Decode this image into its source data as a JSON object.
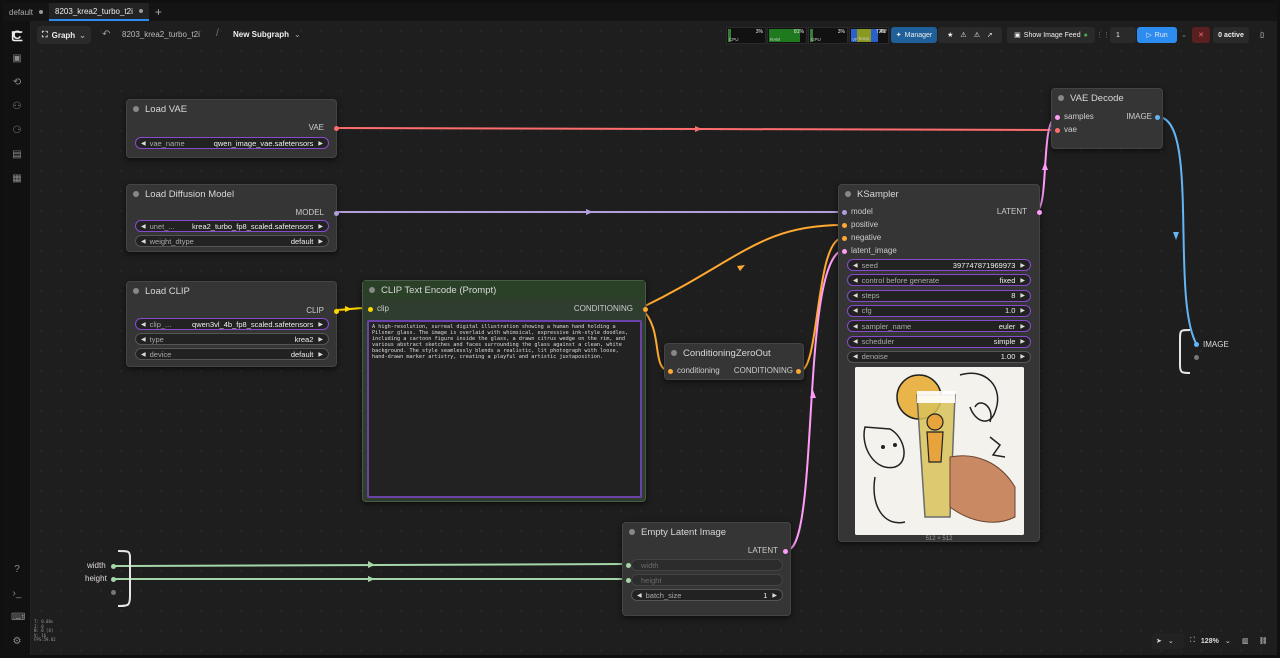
{
  "tabs": [
    {
      "label": "default",
      "active": false
    },
    {
      "label": "8203_krea2_turbo_t2i",
      "active": true
    }
  ],
  "toolbar": {
    "graph_label": "Graph",
    "breadcrumb_workflow": "8203_krea2_turbo_t2i",
    "breadcrumb_sep": "/",
    "breadcrumb_subgraph": "New Subgraph",
    "stats": [
      {
        "label": "CPU",
        "pct": "3%",
        "level": 0.03,
        "color": "#3a7d3a"
      },
      {
        "label": "RAM",
        "pct": "81%",
        "level": 0.81,
        "color": "#1f7a1f"
      },
      {
        "label": "GPU",
        "pct": "3%",
        "level": 0.03,
        "color": "#3a7d3a"
      },
      {
        "label": "VRAM",
        "pct": "72%",
        "level": 0.72,
        "color": "#2b5fc9"
      },
      {
        "label": "Temp",
        "pct": "45°",
        "level": 0.45,
        "color": "#8a9a20"
      }
    ],
    "manager_label": "Manager",
    "image_feed_label": "Show Image Feed",
    "batch_count": "1",
    "run_label": "Run",
    "active_label": "0 active",
    "accent": "#2d8cf0"
  },
  "nodes": {
    "load_vae": {
      "title": "Load VAE",
      "output": "VAE",
      "widget_name": "vae_name",
      "widget_value": "qwen_image_vae.safetensors"
    },
    "load_diffusion": {
      "title": "Load Diffusion Model",
      "output": "MODEL",
      "w1_name": "unet_...",
      "w1_value": "krea2_turbo_fp8_scaled.safetensors",
      "w2_name": "weight_dtype",
      "w2_value": "default"
    },
    "load_clip": {
      "title": "Load CLIP",
      "output": "CLIP",
      "w1_name": "clip_...",
      "w1_value": "qwen3vl_4b_fp8_scaled.safetensors",
      "w2_name": "type",
      "w2_value": "krea2",
      "w3_name": "device",
      "w3_value": "default"
    },
    "clip_text": {
      "title": "CLIP Text Encode (Prompt)",
      "input": "clip",
      "output": "CONDITIONING",
      "prompt": "A high-resolution, surreal digital illustration showing a human hand holding a Pilsner glass. The image is overlaid with whimsical, expressive ink-style doodles, including a cartoon figure inside the glass, a drawn citrus wedge on the rim, and various abstract sketches and faces surrounding the glass against a clean, white background. The style seamlessly blends a realistic, lit photograph with loose, hand-drawn marker artistry, creating a playful and artistic juxtaposition."
    },
    "cond_zero": {
      "title": "ConditioningZeroOut",
      "input": "conditioning",
      "output": "CONDITIONING"
    },
    "ksampler": {
      "title": "KSampler",
      "inputs": [
        "model",
        "positive",
        "negative",
        "latent_image"
      ],
      "output": "LATENT",
      "widgets": [
        {
          "name": "seed",
          "value": "397747871969973"
        },
        {
          "name": "control before generate",
          "value": "fixed"
        },
        {
          "name": "steps",
          "value": "8"
        },
        {
          "name": "cfg",
          "value": "1.0"
        },
        {
          "name": "sampler_name",
          "value": "euler"
        },
        {
          "name": "scheduler",
          "value": "simple"
        },
        {
          "name": "denoise",
          "value": "1.00"
        }
      ],
      "preview_size": "512 × 512"
    },
    "vae_decode": {
      "title": "VAE Decode",
      "inputs": [
        "samples",
        "vae"
      ],
      "output": "IMAGE"
    },
    "empty_latent": {
      "title": "Empty Latent Image",
      "output": "LATENT",
      "w1": "width",
      "w2": "height",
      "w3_name": "batch_size",
      "w3_value": "1"
    }
  },
  "subgraph_inputs": [
    "width",
    "height"
  ],
  "subgraph_output": "IMAGE",
  "bottom_info": [
    "T: 0.00s",
    "I: 0",
    "N: 8 [8]",
    "V: 16",
    "FPS:59.82"
  ],
  "zoom": "128%",
  "colors": {
    "vae": "#ff6e6e",
    "model": "#b39ddb",
    "clip": "#ffd500",
    "conditioning": "#ffa931",
    "latent": "#ff9cf9",
    "image": "#64b5f6",
    "int": "#a5d6a7"
  }
}
